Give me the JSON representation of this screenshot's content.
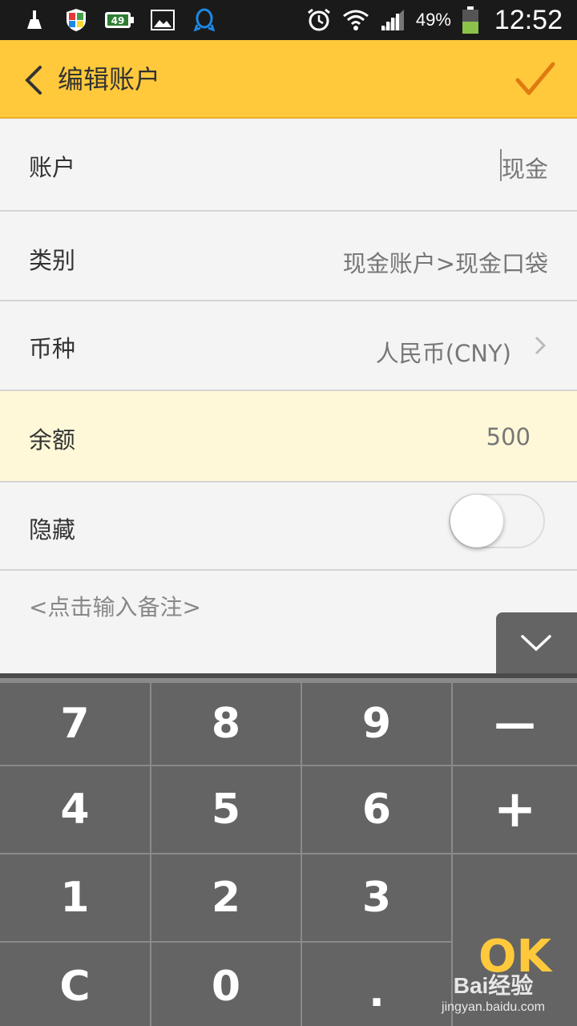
{
  "status_bar": {
    "battery_percent": "49%",
    "time": "12:52",
    "notification_badge": "49",
    "icons": [
      "cleaner-icon",
      "shield-icon",
      "battery-app-icon",
      "gallery-icon",
      "qq-icon",
      "alarm-icon",
      "wifi-icon",
      "signal-icon",
      "battery-icon"
    ]
  },
  "header": {
    "title": "编辑账户",
    "back_icon": "chevron-left-icon",
    "confirm_icon": "check-icon",
    "color": "#ffc93b"
  },
  "form": {
    "account": {
      "label": "账户",
      "value": "现金"
    },
    "category": {
      "label": "类别",
      "value": "现金账户>现金口袋"
    },
    "currency": {
      "label": "币种",
      "value": "人民币(CNY)"
    },
    "balance": {
      "label": "余额",
      "value": "500"
    },
    "hidden": {
      "label": "隐藏",
      "enabled": false
    },
    "notes": {
      "placeholder": "<点击输入备注>"
    }
  },
  "keypad": {
    "keys": [
      "7",
      "8",
      "9",
      "—",
      "4",
      "5",
      "6",
      "+",
      "1",
      "2",
      "3",
      "C",
      "0",
      "."
    ],
    "ok_label": "OK"
  },
  "watermark": {
    "brand": "Bai经验",
    "url": "jingyan.baidu.com"
  }
}
